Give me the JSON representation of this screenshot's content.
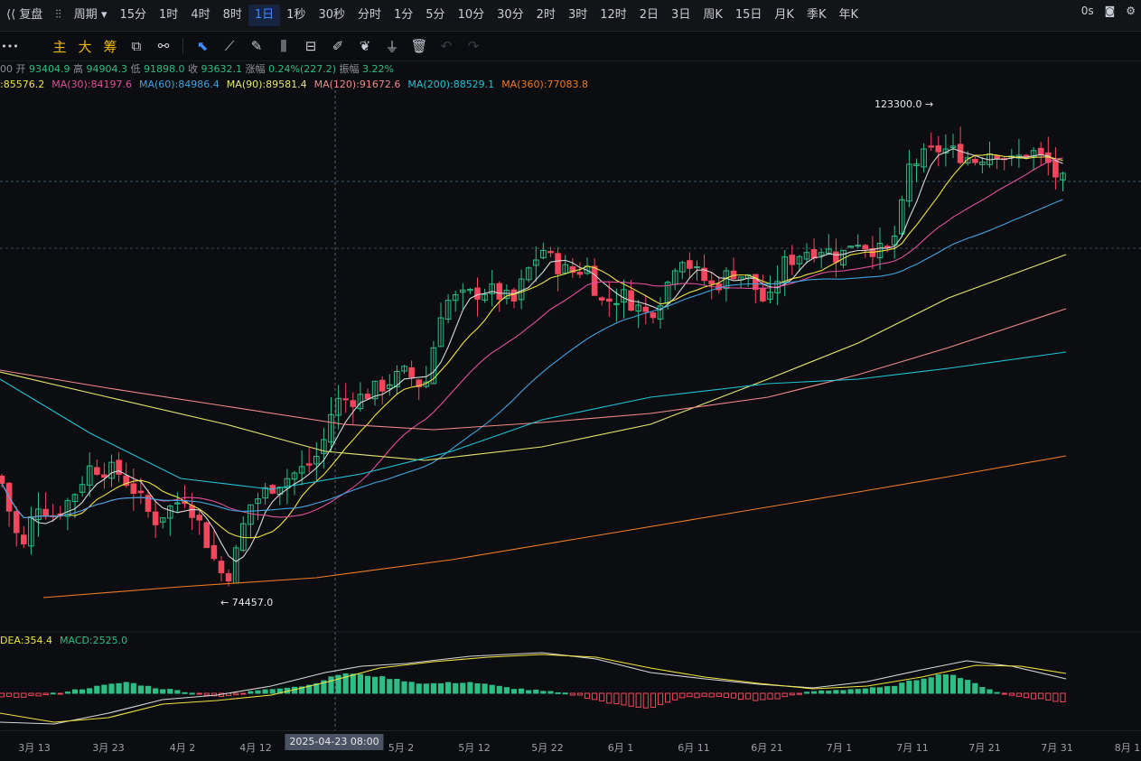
{
  "topbar": {
    "replay_label": "复盘",
    "period_label": "周期",
    "intervals": [
      "15分",
      "1时",
      "4时",
      "8时",
      "1日",
      "1秒",
      "30秒",
      "分时",
      "1分",
      "5分",
      "10分",
      "30分",
      "2时",
      "3时",
      "12时",
      "2日",
      "3日",
      "周K",
      "15日",
      "月K",
      "季K",
      "年K"
    ],
    "active_interval": "1日",
    "latency": "0s"
  },
  "toolbar": {
    "more": "•••",
    "main_label": "主",
    "big_label": "大",
    "chip_label": "筹"
  },
  "ohlc": {
    "date_suffix": "00",
    "open_label": "开",
    "open": "93404.9",
    "high_label": "高",
    "high": "94904.3",
    "low_label": "低",
    "low": "91898.0",
    "close_label": "收",
    "close": "93632.1",
    "chg_label": "涨幅",
    "chg": "0.24%(227.2)",
    "amp_label": "振幅",
    "amp": "3.22%"
  },
  "ma_legend": [
    {
      "label": ":85576.2",
      "color": "#f0e442"
    },
    {
      "label": "MA(30):84197.6",
      "color": "#e0509c"
    },
    {
      "label": "MA(60):84986.4",
      "color": "#3fa3e0"
    },
    {
      "label": "MA(90):89581.4",
      "color": "#e8e870"
    },
    {
      "label": "MA(120):91672.6",
      "color": "#f08a8a"
    },
    {
      "label": "MA(200):88529.1",
      "color": "#1fc4d8"
    },
    {
      "label": "MA(360):77083.8",
      "color": "#f07a22"
    }
  ],
  "macd_legend": [
    {
      "label": "DEA:354.4",
      "color": "#f0e442"
    },
    {
      "label": "MACD:2525.0",
      "color": "#2ebd85"
    }
  ],
  "chart_data": {
    "type": "candlestick",
    "high_marker": "123300.0 →",
    "low_marker": "← 74457.0",
    "x_ticks": [
      "3月 13",
      "3月 23",
      "4月 2",
      "4月 12",
      "5月 2",
      "5月 12",
      "5月 22",
      "6月 1",
      "6月 11",
      "6月 21",
      "7月 1",
      "7月 11",
      "7月 21",
      "7月 31",
      "8月 1"
    ],
    "crosshair_label": "2025-04-23 08:00",
    "colors": {
      "up": "#2ebd85",
      "down": "#f6465d"
    }
  }
}
